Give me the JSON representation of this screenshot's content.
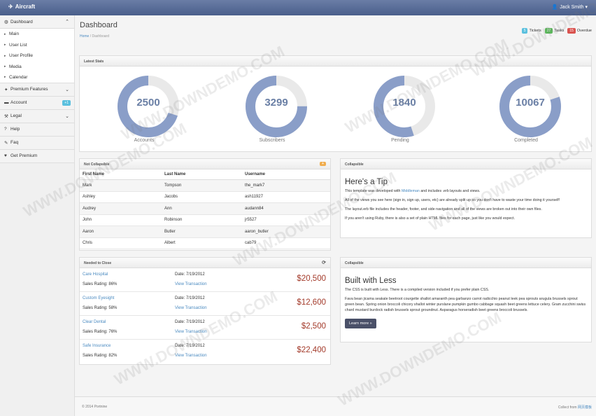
{
  "app": {
    "title": "Aircraft",
    "user": "Jack Smith ▾"
  },
  "sidebar": {
    "dashboard": "Dashboard",
    "sub": [
      "Main",
      "User List",
      "User Profile",
      "Media",
      "Calendar"
    ],
    "premium": "Premium Features",
    "account": "Account",
    "account_badge": "+1",
    "legal": "Legal",
    "help": "Help",
    "faq": "Faq",
    "get_premium": "Get Premium"
  },
  "header": {
    "title": "Dashboard",
    "crumb_home": "Home",
    "crumb_sep": "/",
    "crumb_current": "Dashboard"
  },
  "counts": [
    {
      "value": "5",
      "label": "Tickets",
      "color": "#5bc0de"
    },
    {
      "value": "27",
      "label": "Tasks",
      "color": "#5cb85c"
    },
    {
      "value": "15",
      "label": "Overdue",
      "color": "#d9534f"
    }
  ],
  "stats": {
    "title": "Latest Stats",
    "items": [
      {
        "value": "2500",
        "label": "Accounts",
        "fill": 0.7
      },
      {
        "value": "3299",
        "label": "Subscribers",
        "fill": 0.75
      },
      {
        "value": "1840",
        "label": "Pending",
        "fill": 0.55
      },
      {
        "value": "10067",
        "label": "Completed",
        "fill": 0.8
      }
    ]
  },
  "users_table": {
    "title": "Not Collapsible",
    "badge": "+",
    "headers": [
      "First Name",
      "Last Name",
      "Username"
    ],
    "rows": [
      [
        "Mark",
        "Tompson",
        "the_mark7"
      ],
      [
        "Ashley",
        "Jacobs",
        "ash11927"
      ],
      [
        "Audrey",
        "Ann",
        "audann84"
      ],
      [
        "John",
        "Robinson",
        "jr5527"
      ],
      [
        "Aaron",
        "Butler",
        "aaron_butler"
      ],
      [
        "Chris",
        "Albert",
        "cab79"
      ]
    ]
  },
  "tip": {
    "title": "Collapsible",
    "heading": "Here's a Tip",
    "p1_a": "This template was developed with ",
    "p1_link": "Middleman",
    "p1_b": " and includes .erb layouts and views.",
    "p2": "All of the views you see here (sign in, sign up, users, etc) are already split up so you don't have to waste your time doing it yourself!",
    "p3": "The layout.erb file includes the header, footer, and side navigation and all of the views are broken out into their own files.",
    "p4": "If you aren't using Ruby, there is also a set of plain HTML files for each page, just like you would expect."
  },
  "close": {
    "title": "Needed to Close",
    "rows": [
      {
        "name": "Care Hospital",
        "rating": "Sales Rating: 86%",
        "date": "Date: 7/19/2012",
        "view": "View Transaction",
        "amount": "$20,500"
      },
      {
        "name": "Custom Eyesight",
        "rating": "Sales Rating: 58%",
        "date": "Date: 7/19/2012",
        "view": "View Transaction",
        "amount": "$12,600"
      },
      {
        "name": "Clear Dental",
        "rating": "Sales Rating: 76%",
        "date": "Date: 7/19/2012",
        "view": "View Transaction",
        "amount": "$2,500"
      },
      {
        "name": "Safe Insurance",
        "rating": "Sales Rating: 82%",
        "date": "Date: 7/19/2012",
        "view": "View Transaction",
        "amount": "$22,400"
      }
    ]
  },
  "less": {
    "title": "Collapsible",
    "heading": "Built with Less",
    "p1": "The CSS is built with Less. There is a compiled version included if you prefer plain CSS.",
    "p2": "Fava bean jicama seakale beetroot courgette shallot amaranth pea garbanzo carrot radicchio peanut leek pea sprouts arugula brussels sprout green bean. Spring onion broccoli chicory shallot winter purslane pumpkin gumbo cabbage squash beet greens lettuce celery. Gram zucchini swiss chard mustard burdock radish brussels sprout groundnut. Asparagus horseradish beet greens broccoli brussels.",
    "button": "Learn more »"
  },
  "footer": {
    "left": "© 2014 Portnine",
    "right_prefix": "Collect from ",
    "right_link": "网页模板"
  },
  "watermark": "WWW.DOWNDEMO.COM",
  "colors": {
    "donut": "#8a9ec8",
    "donut_bg": "#e9e9e9",
    "topbar": "#4a5f8b"
  }
}
